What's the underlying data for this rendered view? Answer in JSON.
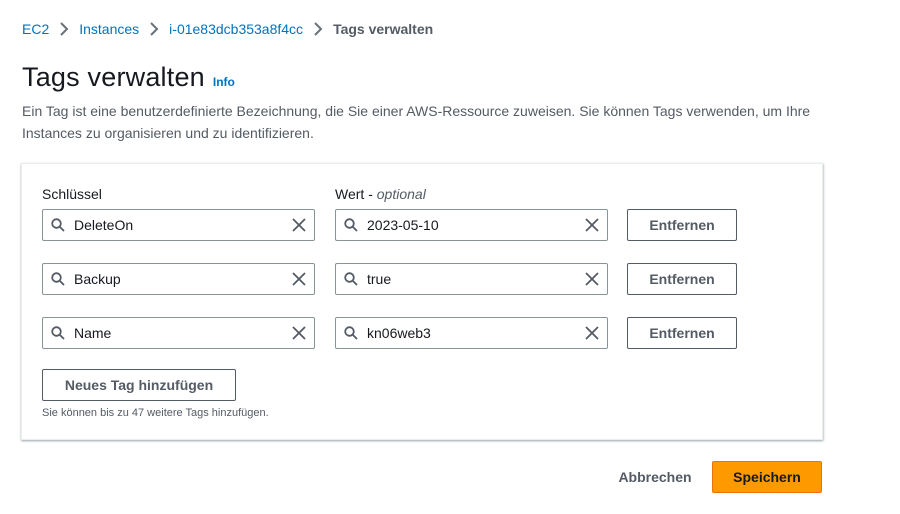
{
  "breadcrumb": {
    "items": [
      "EC2",
      "Instances",
      "i-01e83dcb353a8f4cc"
    ],
    "current": "Tags verwalten"
  },
  "header": {
    "title": "Tags verwalten",
    "info_link": "Info",
    "description": "Ein Tag ist eine benutzerdefinierte Bezeichnung, die Sie einer AWS-Ressource zuweisen. Sie können Tags verwenden, um Ihre Instances zu organisieren und zu identifizieren."
  },
  "tags_panel": {
    "key_label": "Schlüssel",
    "value_label": "Wert",
    "value_optional": "optional",
    "rows": [
      {
        "key": "DeleteOn",
        "value": "2023-05-10",
        "remove_label": "Entfernen"
      },
      {
        "key": "Backup",
        "value": "true",
        "remove_label": "Entfernen"
      },
      {
        "key": "Name",
        "value": "kn06web3",
        "remove_label": "Entfernen"
      }
    ],
    "add_button": "Neues Tag hinzufügen",
    "hint": "Sie können bis zu 47 weitere Tags hinzufügen."
  },
  "footer": {
    "cancel_label": "Abbrechen",
    "save_label": "Speichern"
  },
  "colors": {
    "link": "#0073bb",
    "primary_button": "#ff9900",
    "text_secondary": "#545b64"
  },
  "icons": {
    "field_prefix": "search-icon",
    "field_suffix": "clear-icon",
    "breadcrumb_separator": "chevron-right-icon"
  }
}
